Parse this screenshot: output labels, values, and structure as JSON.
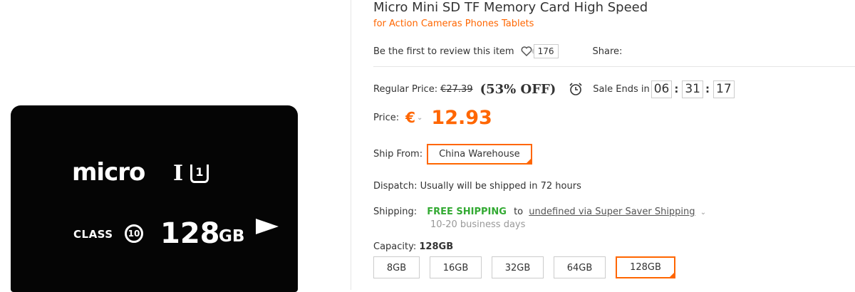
{
  "product": {
    "title": "Micro Mini SD TF Memory Card High Speed",
    "subtitle": "for Action Cameras Phones Tablets",
    "image": {
      "brand_text": "micro",
      "uhs_text": "I",
      "uhs_number": "1",
      "class_text": "CLASS",
      "class_number": "10",
      "capacity_number": "128",
      "capacity_unit": "GB"
    }
  },
  "reviews": {
    "link_text": "Be the first to review this item",
    "favorite_count": "176",
    "share_label": "Share:"
  },
  "pricing": {
    "regular_label": "Regular Price:",
    "regular_price": "€27.39",
    "discount": "(53% OFF)",
    "sale_ends_label": "Sale Ends in",
    "countdown": {
      "hours": "06",
      "minutes": "31",
      "seconds": "17"
    },
    "price_label": "Price:",
    "currency_symbol": "€",
    "price": "12.93"
  },
  "shipping": {
    "ship_from_label": "Ship From:",
    "ship_from_value": "China Warehouse",
    "dispatch_text": "Dispatch: Usually will be shipped in 72 hours",
    "shipping_label": "Shipping:",
    "free_shipping": "FREE SHIPPING",
    "to_text": "to",
    "method": "undefined via Super Saver Shipping",
    "days": "10-20 business days"
  },
  "capacity": {
    "label": "Capacity:",
    "selected": "128GB",
    "options": [
      "8GB",
      "16GB",
      "32GB",
      "64GB",
      "128GB"
    ]
  },
  "colors": {
    "accent": "#ff6600",
    "free_shipping": "#33aa33"
  }
}
